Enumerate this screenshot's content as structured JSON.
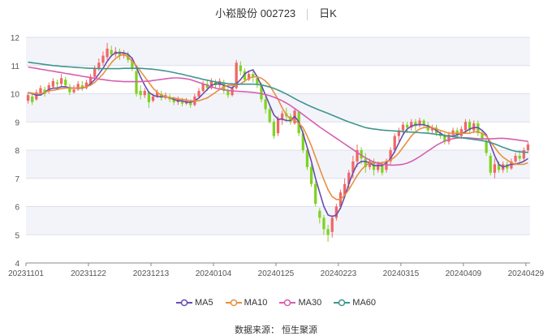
{
  "header": {
    "stock_title": "小崧股份 002723",
    "period": "日K"
  },
  "source_text": "数据来源： 恒生聚源",
  "colors": {
    "up": "#f06767",
    "down": "#7ed321",
    "ma5": "#6a4cb1",
    "ma10": "#e8903f",
    "ma30": "#d85db0",
    "ma60": "#3e958f",
    "band": "#f3f4fa",
    "grid": "#dde0ea"
  },
  "chart_data": {
    "type": "candlestick",
    "title": "小崧股份 002723 日K",
    "ylim": [
      4,
      12
    ],
    "y_ticks": [
      4,
      5,
      6,
      7,
      8,
      9,
      10,
      11,
      12
    ],
    "x_tick_labels": [
      "20231101",
      "20231122",
      "20231213",
      "20240104",
      "20240125",
      "20240223",
      "20240315",
      "20240409",
      "20240429"
    ],
    "x_tick_index": [
      0,
      15,
      30,
      45,
      60,
      75,
      90,
      105,
      120
    ],
    "candles": [
      [
        9.75,
        9.95,
        9.65,
        10.05
      ],
      [
        9.9,
        9.7,
        9.6,
        10.0
      ],
      [
        9.8,
        10.05,
        9.75,
        10.15
      ],
      [
        10.0,
        10.2,
        9.95,
        10.3
      ],
      [
        10.15,
        10.0,
        9.9,
        10.25
      ],
      [
        10.1,
        10.3,
        10.0,
        10.4
      ],
      [
        10.25,
        10.45,
        10.2,
        10.55
      ],
      [
        10.4,
        10.35,
        10.2,
        10.5
      ],
      [
        10.35,
        10.55,
        10.25,
        10.7
      ],
      [
        10.5,
        10.3,
        10.2,
        10.6
      ],
      [
        10.25,
        10.05,
        9.95,
        10.35
      ],
      [
        10.05,
        10.15,
        10.0,
        10.3
      ],
      [
        10.15,
        10.35,
        10.1,
        10.45
      ],
      [
        10.3,
        10.2,
        10.1,
        10.45
      ],
      [
        10.2,
        10.4,
        10.15,
        10.5
      ],
      [
        10.35,
        10.6,
        10.3,
        10.7
      ],
      [
        10.6,
        10.9,
        10.55,
        11.0
      ],
      [
        10.9,
        11.1,
        10.8,
        11.25
      ],
      [
        11.1,
        11.35,
        11.0,
        11.5
      ],
      [
        11.3,
        11.6,
        11.2,
        11.8
      ],
      [
        11.55,
        11.4,
        11.3,
        11.7
      ],
      [
        11.4,
        11.5,
        11.3,
        11.65
      ],
      [
        11.5,
        11.35,
        11.2,
        11.6
      ],
      [
        11.35,
        11.45,
        11.25,
        11.55
      ],
      [
        11.4,
        11.2,
        11.1,
        11.5
      ],
      [
        11.2,
        10.9,
        10.8,
        11.3
      ],
      [
        10.8,
        10.0,
        9.9,
        10.9
      ],
      [
        10.1,
        9.95,
        9.8,
        10.3
      ],
      [
        9.95,
        10.1,
        9.85,
        10.2
      ],
      [
        10.05,
        9.7,
        9.5,
        10.1
      ],
      [
        9.75,
        9.9,
        9.7,
        10.0
      ],
      [
        9.9,
        10.05,
        9.85,
        10.15
      ],
      [
        10.0,
        9.85,
        9.75,
        10.1
      ],
      [
        9.85,
        9.95,
        9.8,
        10.05
      ],
      [
        9.9,
        9.8,
        9.7,
        10.0
      ],
      [
        9.8,
        9.7,
        9.6,
        9.9
      ],
      [
        9.7,
        9.8,
        9.6,
        9.9
      ],
      [
        9.75,
        9.65,
        9.55,
        9.85
      ],
      [
        9.65,
        9.75,
        9.6,
        9.85
      ],
      [
        9.7,
        9.6,
        9.5,
        9.8
      ],
      [
        9.6,
        9.9,
        9.55,
        10.0
      ],
      [
        9.9,
        10.1,
        9.85,
        10.2
      ],
      [
        10.1,
        10.35,
        10.05,
        10.45
      ],
      [
        10.35,
        10.2,
        10.1,
        10.5
      ],
      [
        10.2,
        10.45,
        10.15,
        10.55
      ],
      [
        10.4,
        10.3,
        10.2,
        10.5
      ],
      [
        10.3,
        10.45,
        10.2,
        10.55
      ],
      [
        10.4,
        10.1,
        10.0,
        10.5
      ],
      [
        10.1,
        9.95,
        9.85,
        10.2
      ],
      [
        9.95,
        10.2,
        9.9,
        10.3
      ],
      [
        10.2,
        11.1,
        10.15,
        11.2
      ],
      [
        11.0,
        10.8,
        10.65,
        11.15
      ],
      [
        10.8,
        10.5,
        10.4,
        10.9
      ],
      [
        10.5,
        10.7,
        10.45,
        10.8
      ],
      [
        10.7,
        10.6,
        10.4,
        10.8
      ],
      [
        10.55,
        10.35,
        10.2,
        10.65
      ],
      [
        10.3,
        9.8,
        9.7,
        10.4
      ],
      [
        9.8,
        9.45,
        9.3,
        9.9
      ],
      [
        9.45,
        9.0,
        8.95,
        9.55
      ],
      [
        9.0,
        8.5,
        8.4,
        9.1
      ],
      [
        8.6,
        9.1,
        8.5,
        9.2
      ],
      [
        9.1,
        9.3,
        8.9,
        9.4
      ],
      [
        9.3,
        9.2,
        9.0,
        9.5
      ],
      [
        9.2,
        9.0,
        8.9,
        9.3
      ],
      [
        8.95,
        9.4,
        8.9,
        9.5
      ],
      [
        9.35,
        8.6,
        8.5,
        9.4
      ],
      [
        8.6,
        8.0,
        7.9,
        8.7
      ],
      [
        8.0,
        7.4,
        7.3,
        8.1
      ],
      [
        7.4,
        6.8,
        6.7,
        7.5
      ],
      [
        6.8,
        6.1,
        6.0,
        6.9
      ],
      [
        5.85,
        5.6,
        5.4,
        5.95
      ],
      [
        5.6,
        5.2,
        5.0,
        5.7
      ],
      [
        5.2,
        5.0,
        4.75,
        5.35
      ],
      [
        5.1,
        5.6,
        4.9,
        5.7
      ],
      [
        5.6,
        6.0,
        5.5,
        6.1
      ],
      [
        6.0,
        6.5,
        5.9,
        6.6
      ],
      [
        6.4,
        6.8,
        6.3,
        7.0
      ],
      [
        6.8,
        7.2,
        6.6,
        7.3
      ],
      [
        7.2,
        7.6,
        7.0,
        7.8
      ],
      [
        7.6,
        8.0,
        7.4,
        8.2
      ],
      [
        8.0,
        7.7,
        7.5,
        8.1
      ],
      [
        7.7,
        7.4,
        7.2,
        7.9
      ],
      [
        7.4,
        7.6,
        7.3,
        7.7
      ],
      [
        7.6,
        7.3,
        7.1,
        7.7
      ],
      [
        7.3,
        7.5,
        7.2,
        7.6
      ],
      [
        7.5,
        7.2,
        7.1,
        7.6
      ],
      [
        7.3,
        7.6,
        7.2,
        7.7
      ],
      [
        7.6,
        8.0,
        7.5,
        8.1
      ],
      [
        8.0,
        8.5,
        7.9,
        8.6
      ],
      [
        8.5,
        8.7,
        8.3,
        8.8
      ],
      [
        8.7,
        8.9,
        8.6,
        9.0
      ],
      [
        8.9,
        8.8,
        8.6,
        9.0
      ],
      [
        8.8,
        9.0,
        8.7,
        9.1
      ],
      [
        9.0,
        8.85,
        8.7,
        9.1
      ],
      [
        8.9,
        9.05,
        8.8,
        9.15
      ],
      [
        9.05,
        8.9,
        8.8,
        9.1
      ],
      [
        8.9,
        8.7,
        8.6,
        9.0
      ],
      [
        8.7,
        8.8,
        8.6,
        8.9
      ],
      [
        8.8,
        8.6,
        8.5,
        8.9
      ],
      [
        8.6,
        8.5,
        8.4,
        8.7
      ],
      [
        8.5,
        8.3,
        8.2,
        8.6
      ],
      [
        8.3,
        8.55,
        8.2,
        8.65
      ],
      [
        8.55,
        8.7,
        8.45,
        8.8
      ],
      [
        8.7,
        8.5,
        8.4,
        8.8
      ],
      [
        8.5,
        8.75,
        8.4,
        8.85
      ],
      [
        8.7,
        9.0,
        8.6,
        9.1
      ],
      [
        9.0,
        8.7,
        8.6,
        9.1
      ],
      [
        8.7,
        8.95,
        8.6,
        9.05
      ],
      [
        8.95,
        8.6,
        8.5,
        9.05
      ],
      [
        8.6,
        8.4,
        8.3,
        8.7
      ],
      [
        8.3,
        7.9,
        7.8,
        8.4
      ],
      [
        7.8,
        7.2,
        7.1,
        7.9
      ],
      [
        7.2,
        7.5,
        7.0,
        7.7
      ],
      [
        7.5,
        7.3,
        7.2,
        7.6
      ],
      [
        7.3,
        7.5,
        7.2,
        7.6
      ],
      [
        7.5,
        7.35,
        7.2,
        7.6
      ],
      [
        7.35,
        7.6,
        7.3,
        7.7
      ],
      [
        7.6,
        7.8,
        7.5,
        7.9
      ],
      [
        7.8,
        7.7,
        7.6,
        8.0
      ],
      [
        7.7,
        8.0,
        7.6,
        8.1
      ],
      [
        8.0,
        8.2,
        7.9,
        8.3
      ]
    ],
    "series": [
      {
        "name": "MA5",
        "color": "#6a4cb1",
        "values": [
          10.05,
          10.0,
          9.95,
          9.95,
          10.05,
          10.15,
          10.2,
          10.2,
          10.25,
          10.25,
          10.2,
          10.2,
          10.2,
          10.2,
          10.25,
          10.35,
          10.5,
          10.7,
          10.9,
          11.15,
          11.35,
          11.45,
          11.45,
          11.45,
          11.4,
          11.25,
          10.95,
          10.6,
          10.3,
          10.05,
          9.95,
          9.9,
          9.9,
          9.9,
          9.85,
          9.8,
          9.75,
          9.75,
          9.7,
          9.7,
          9.75,
          9.85,
          10.0,
          10.15,
          10.3,
          10.35,
          10.35,
          10.3,
          10.25,
          10.2,
          10.35,
          10.5,
          10.7,
          10.8,
          10.85,
          10.6,
          10.3,
          9.95,
          9.6,
          9.25,
          9.1,
          9.1,
          9.05,
          9.05,
          9.2,
          9.0,
          8.6,
          8.1,
          7.6,
          7.0,
          6.5,
          6.0,
          5.7,
          5.65,
          5.7,
          5.95,
          6.35,
          6.8,
          7.2,
          7.5,
          7.6,
          7.6,
          7.55,
          7.45,
          7.45,
          7.45,
          7.55,
          7.7,
          7.95,
          8.25,
          8.55,
          8.75,
          8.85,
          8.9,
          8.9,
          8.9,
          8.85,
          8.8,
          8.7,
          8.6,
          8.5,
          8.5,
          8.5,
          8.55,
          8.6,
          8.65,
          8.75,
          8.8,
          8.8,
          8.7,
          8.55,
          8.2,
          7.8,
          7.5,
          7.4,
          7.45,
          7.5,
          7.5,
          7.55,
          7.6,
          7.7
        ]
      },
      {
        "name": "MA10",
        "color": "#e8903f",
        "values": [
          10.05,
          10.02,
          10.0,
          10.0,
          10.05,
          10.1,
          10.12,
          10.15,
          10.18,
          10.2,
          10.2,
          10.2,
          10.2,
          10.22,
          10.25,
          10.3,
          10.4,
          10.55,
          10.7,
          10.9,
          11.1,
          11.25,
          11.35,
          11.4,
          11.3,
          11.15,
          11.0,
          10.8,
          10.6,
          10.4,
          10.2,
          10.05,
          9.95,
          9.9,
          9.85,
          9.85,
          9.82,
          9.8,
          9.78,
          9.75,
          9.75,
          9.75,
          9.8,
          9.85,
          9.95,
          10.05,
          10.15,
          10.25,
          10.3,
          10.3,
          10.3,
          10.35,
          10.45,
          10.55,
          10.6,
          10.6,
          10.55,
          10.45,
          10.3,
          10.05,
          9.8,
          9.5,
          9.25,
          9.1,
          9.05,
          8.95,
          8.8,
          8.5,
          8.15,
          7.75,
          7.35,
          6.95,
          6.6,
          6.35,
          6.25,
          6.25,
          6.4,
          6.6,
          6.85,
          7.1,
          7.3,
          7.45,
          7.55,
          7.55,
          7.55,
          7.55,
          7.6,
          7.65,
          7.75,
          7.9,
          8.1,
          8.3,
          8.5,
          8.65,
          8.75,
          8.8,
          8.8,
          8.8,
          8.75,
          8.7,
          8.65,
          8.6,
          8.6,
          8.6,
          8.6,
          8.6,
          8.6,
          8.65,
          8.65,
          8.6,
          8.5,
          8.3,
          8.1,
          7.9,
          7.75,
          7.65,
          7.55,
          7.5,
          7.5,
          7.5,
          7.55
        ]
      },
      {
        "name": "MA30",
        "color": "#d85db0",
        "values": [
          10.95,
          10.92,
          10.9,
          10.87,
          10.85,
          10.82,
          10.8,
          10.77,
          10.75,
          10.72,
          10.7,
          10.67,
          10.65,
          10.62,
          10.6,
          10.57,
          10.55,
          10.52,
          10.5,
          10.48,
          10.46,
          10.45,
          10.44,
          10.43,
          10.43,
          10.43,
          10.43,
          10.43,
          10.44,
          10.45,
          10.47,
          10.49,
          10.51,
          10.53,
          10.55,
          10.56,
          10.56,
          10.55,
          10.53,
          10.5,
          10.45,
          10.4,
          10.35,
          10.3,
          10.25,
          10.2,
          10.17,
          10.14,
          10.12,
          10.1,
          10.09,
          10.08,
          10.07,
          10.06,
          10.05,
          10.03,
          10.0,
          9.97,
          9.93,
          9.88,
          9.82,
          9.75,
          9.67,
          9.58,
          9.48,
          9.37,
          9.26,
          9.15,
          9.04,
          8.93,
          8.82,
          8.72,
          8.62,
          8.52,
          8.42,
          8.32,
          8.22,
          8.12,
          8.02,
          7.92,
          7.82,
          7.73,
          7.65,
          7.58,
          7.53,
          7.5,
          7.48,
          7.47,
          7.47,
          7.48,
          7.5,
          7.54,
          7.6,
          7.68,
          7.77,
          7.87,
          7.97,
          8.07,
          8.17,
          8.25,
          8.32,
          8.37,
          8.41,
          8.43,
          8.44,
          8.44,
          8.43,
          8.42,
          8.41,
          8.4,
          8.4,
          8.4,
          8.41,
          8.42,
          8.42,
          8.41,
          8.39,
          8.37,
          8.35,
          8.33,
          8.31
        ]
      },
      {
        "name": "MA60",
        "color": "#3e958f",
        "values": [
          11.12,
          11.1,
          11.08,
          11.06,
          11.04,
          11.02,
          11.0,
          10.99,
          10.97,
          10.96,
          10.95,
          10.94,
          10.93,
          10.92,
          10.91,
          10.9,
          10.9,
          10.89,
          10.89,
          10.89,
          10.89,
          10.89,
          10.89,
          10.9,
          10.9,
          10.9,
          10.9,
          10.9,
          10.89,
          10.88,
          10.87,
          10.85,
          10.83,
          10.81,
          10.78,
          10.75,
          10.72,
          10.69,
          10.65,
          10.62,
          10.58,
          10.55,
          10.51,
          10.48,
          10.45,
          10.42,
          10.4,
          10.38,
          10.36,
          10.35,
          10.34,
          10.34,
          10.34,
          10.34,
          10.34,
          10.33,
          10.31,
          10.28,
          10.24,
          10.19,
          10.13,
          10.06,
          9.99,
          9.91,
          9.83,
          9.75,
          9.68,
          9.61,
          9.54,
          9.48,
          9.42,
          9.36,
          9.3,
          9.24,
          9.18,
          9.12,
          9.06,
          9.0,
          8.95,
          8.9,
          8.85,
          8.8,
          8.77,
          8.75,
          8.73,
          8.71,
          8.7,
          8.69,
          8.68,
          8.67,
          8.66,
          8.65,
          8.64,
          8.63,
          8.62,
          8.61,
          8.6,
          8.58,
          8.56,
          8.54,
          8.52,
          8.5,
          8.48,
          8.46,
          8.44,
          8.42,
          8.4,
          8.38,
          8.36,
          8.34,
          8.31,
          8.27,
          8.22,
          8.16,
          8.1,
          8.05,
          8.0,
          7.96,
          7.94,
          7.93,
          7.92
        ]
      }
    ]
  }
}
